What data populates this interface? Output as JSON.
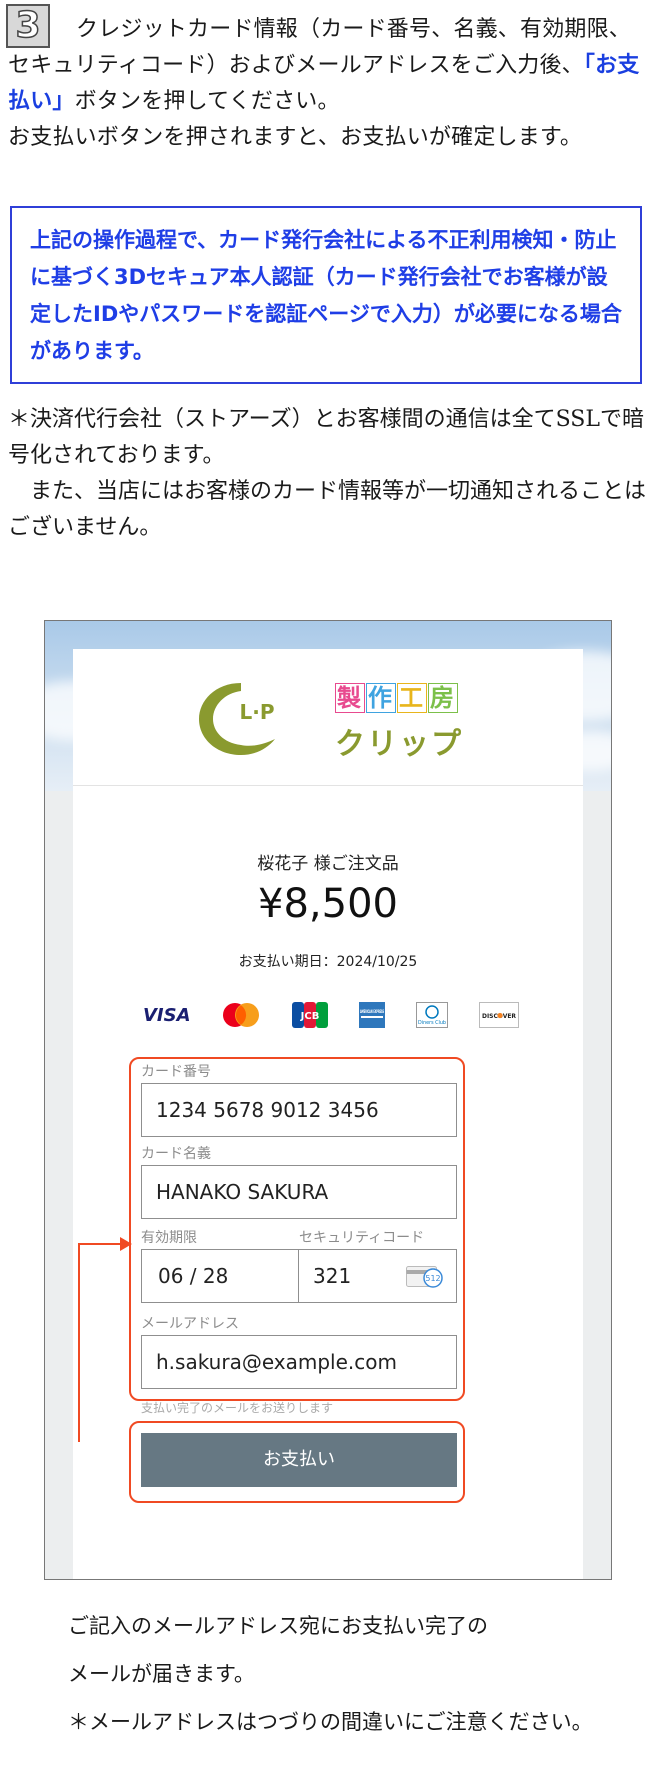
{
  "step": {
    "number": "3"
  },
  "intro": {
    "before": "クレジットカード情報（カード番号、名義、有効期限、セキュリティコード）およびメールアドレスをご入力後、",
    "button_ref": "「お支払い」",
    "after": "ボタンを押してください。",
    "line2": "お支払いボタンを押されますと、お支払いが確定します。"
  },
  "notice": "上記の操作過程で、カード発行会社による不正利用検知・防止に基づく3Dセキュア本人認証（カード発行会社でお客様が設定したIDやパスワードを認証ページで入力）が必要になる場合があります。",
  "ssl_note": {
    "p1": "＊決済代行会社（ストアーズ）とお客様間の通信は全てSSLで暗号化されております。",
    "p2": "また、当店にはお客様のカード情報等が一切通知されることはございません。"
  },
  "shop": {
    "logo_letters": "L·P",
    "logo_top": [
      "製",
      "作",
      "工",
      "房"
    ],
    "logo_top_colors": [
      "#e84a8f",
      "#3fa3e0",
      "#e8b51c",
      "#7cc04a"
    ],
    "logo_bottom": "クリップ",
    "logo_color": "#8a9a2f"
  },
  "order": {
    "title": "桜花子 様ご注文品",
    "amount": "¥8,500",
    "due": "お支払い期日：2024/10/25"
  },
  "brands": {
    "visa": "VISA",
    "jcb": "JCB",
    "amex": "AMERICAN EXPRESS",
    "diners": "Diners Club",
    "discover": "DISCOVER"
  },
  "form": {
    "card_number_label": "カード番号",
    "card_number_value": "1234 5678 9012 3456",
    "card_name_label": "カード名義",
    "card_name_value": "HANAKO SAKURA",
    "expiry_label": "有効期限",
    "expiry_value": "06 / 28",
    "cvc_label": "セキュリティコード",
    "cvc_value": "321",
    "cvc_icon_text": "512",
    "email_label": "メールアドレス",
    "email_value": "h.sakura@example.com",
    "email_helper": "支払い完了のメールをお送りします",
    "pay_button": "お支払い"
  },
  "footer": {
    "line1": "ご記入のメールアドレス宛にお支払い完了の",
    "line2": "メールが届きます。",
    "line3": "＊メールアドレスはつづりの間違いにご注意ください。"
  },
  "colors": {
    "accent_blue": "#1f3ee6",
    "highlight_red": "#f04a23",
    "pay_button": "#667883"
  }
}
